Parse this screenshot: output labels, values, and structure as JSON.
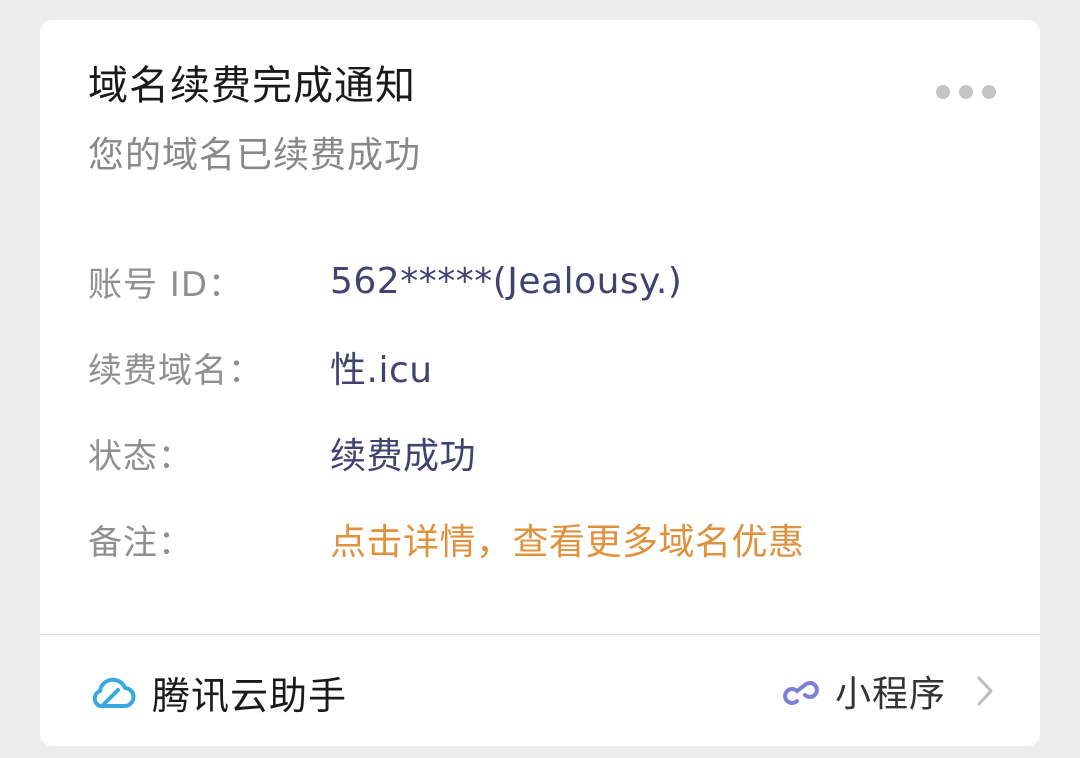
{
  "card": {
    "title": "域名续费完成通知",
    "subtitle": "您的域名已续费成功",
    "more_icon": "more-dots-icon",
    "rows": [
      {
        "label": "账号 ID：",
        "value": "562*****(Jealousy.)"
      },
      {
        "label": "续费域名：",
        "value": "性.icu"
      },
      {
        "label": "状态：",
        "value": "续费成功"
      },
      {
        "label": "备注：",
        "value": "点击详情，查看更多域名优惠"
      }
    ],
    "footer": {
      "brand_icon": "tencent-cloud-icon",
      "brand_name": "腾讯云助手",
      "mini_icon": "mini-program-link-icon",
      "mini_label": "小程序",
      "chevron_icon": "chevron-right-icon"
    }
  },
  "colors": {
    "background": "#ededed",
    "card": "#ffffff",
    "title": "#1a1a1a",
    "label": "#8f8f8f",
    "value": "#3f4370",
    "highlight": "#e0913d",
    "cloud_icon": "#38a9e0",
    "mini_icon": "#7b7fd6"
  }
}
